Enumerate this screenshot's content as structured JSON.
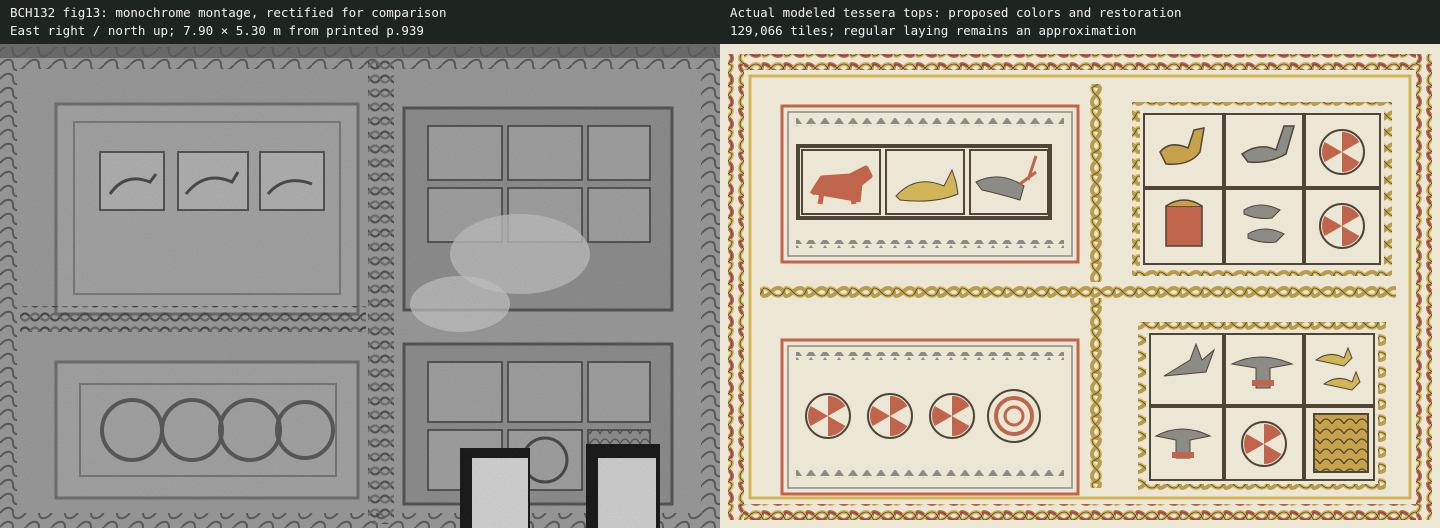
{
  "left": {
    "caption_line1": "BCH132 fig13: monochrome montage, rectified for comparison",
    "caption_line2": "East right / north up; 7.90 × 5.30 m from printed p.939"
  },
  "right": {
    "caption_line1": "Actual modeled tessera tops: proposed colors and restoration",
    "caption_line2": "129,066 tiles; regular laying remains an approximation"
  },
  "colors": {
    "ground": "#ece6d4",
    "red": "#c0654b",
    "ochre": "#d3b559",
    "dark": "#4f4538",
    "grey": "#8c8c86"
  }
}
